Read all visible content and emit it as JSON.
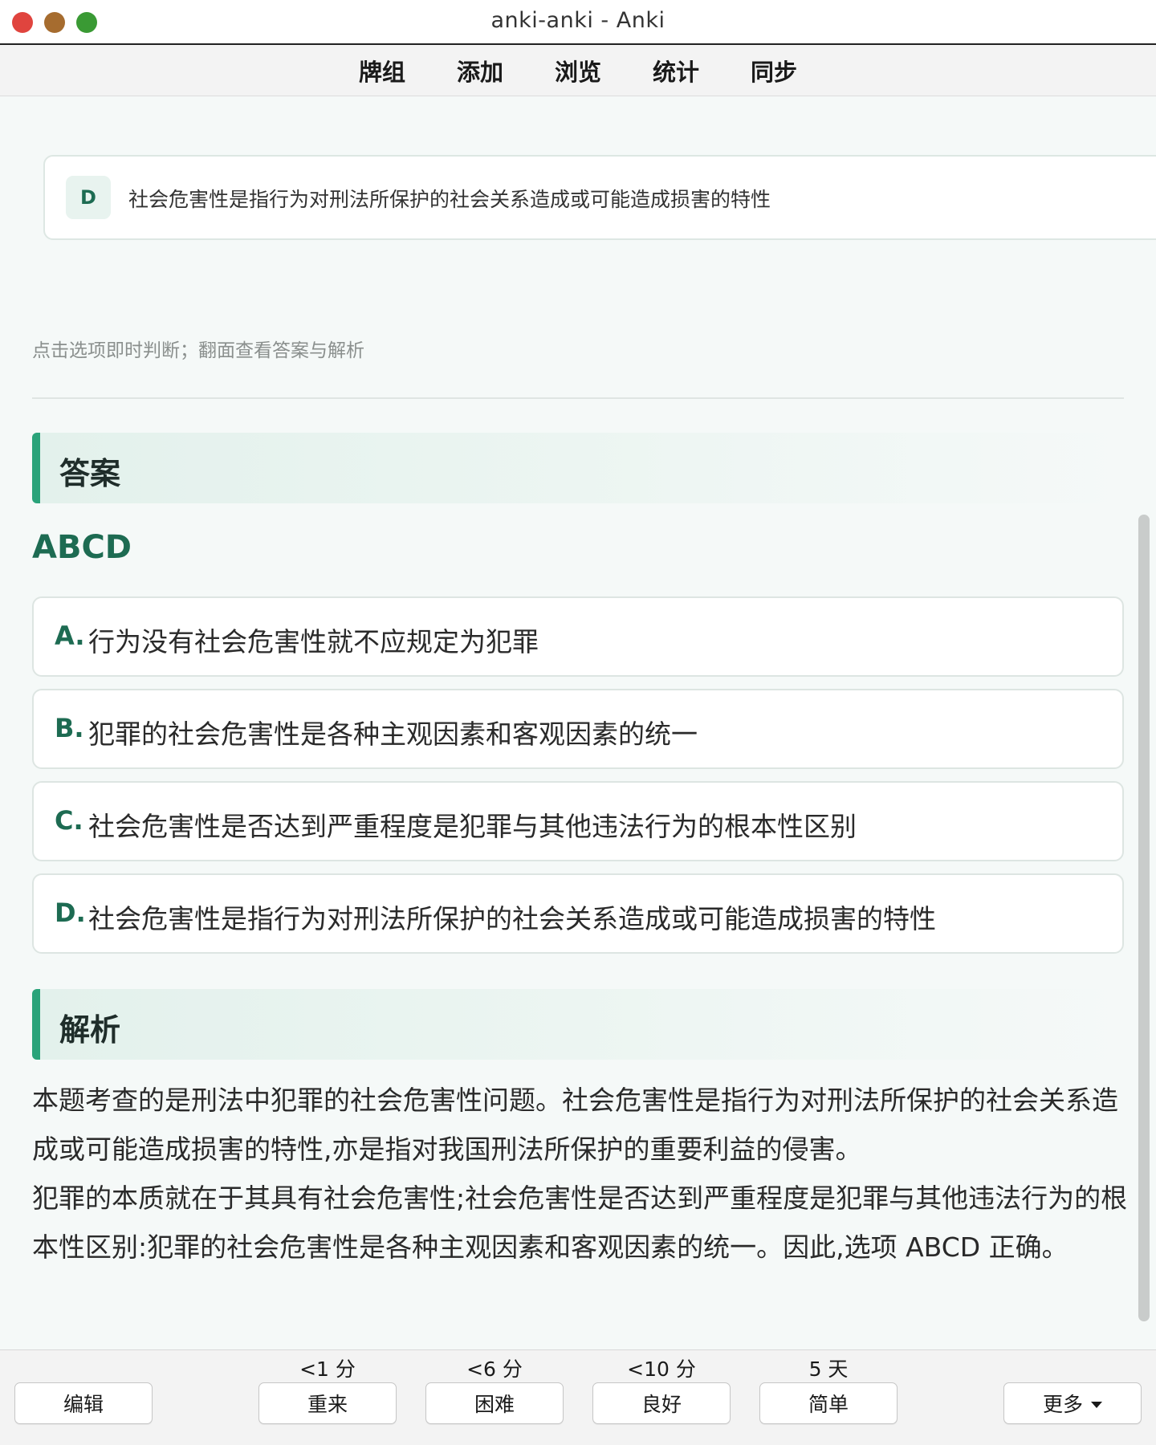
{
  "window": {
    "title": "anki-anki - Anki"
  },
  "toolbar": {
    "items": [
      "牌组",
      "添加",
      "浏览",
      "统计",
      "同步"
    ]
  },
  "question": {
    "option_card": {
      "letter": "D",
      "text": "社会危害性是指行为对刑法所保护的社会关系造成或可能造成损害的特性"
    },
    "hint": "点击选项即时判断；翻面查看答案与解析"
  },
  "answer": {
    "heading": "答案",
    "code": "ABCD",
    "choices": [
      {
        "letter": "A.",
        "text": "行为没有社会危害性就不应规定为犯罪"
      },
      {
        "letter": "B.",
        "text": "犯罪的社会危害性是各种主观因素和客观因素的统一"
      },
      {
        "letter": "C.",
        "text": "社会危害性是否达到严重程度是犯罪与其他违法行为的根本性区别"
      },
      {
        "letter": "D.",
        "text": "社会危害性是指行为对刑法所保护的社会关系造成或可能造成损害的特性"
      }
    ]
  },
  "analysis": {
    "heading": "解析",
    "paragraphs": [
      "本题考查的是刑法中犯罪的社会危害性问题。社会危害性是指行为对刑法所保护的社会关系造成或可能造成损害的特性,亦是指对我国刑法所保护的重要利益的侵害。",
      "犯罪的本质就在于其具有社会危害性;社会危害性是否达到严重程度是犯罪与其他违法行为的根本性区别:犯罪的社会危害性是各种主观因素和客观因素的统一。因此,选项 ABCD 正确。"
    ]
  },
  "bottom": {
    "edit": "编辑",
    "answers": [
      {
        "interval": "<1 分",
        "label": "重来"
      },
      {
        "interval": "<6 分",
        "label": "困难"
      },
      {
        "interval": "<10 分",
        "label": "良好"
      },
      {
        "interval": "5 天",
        "label": "简单"
      }
    ],
    "more": "更多"
  },
  "colors": {
    "accent": "#2aa37a",
    "accent_text": "#1d6b52",
    "close": "#e0443e",
    "minimize": "#a66c2f",
    "maximize": "#3a9a34"
  },
  "icons": {
    "more_caret": "chevron-down-icon"
  }
}
